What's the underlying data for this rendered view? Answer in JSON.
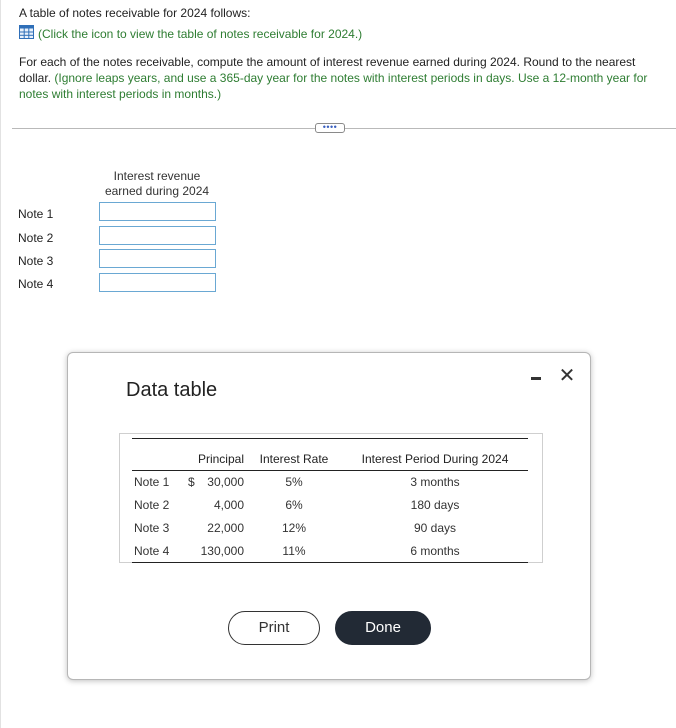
{
  "intro": "A table of notes receivable for 2024 follows:",
  "link": {
    "text": "(Click the icon to view the table of notes receivable for",
    "year": "2024.)"
  },
  "instructions": {
    "main": "For each of the notes receivable, compute the amount of interest revenue earned during 2024. Round to the nearest dollar.",
    "hint": "(Ignore leaps years, and use a 365-day year for the notes with interest periods in days. Use a 12-month year for notes with interest periods in months.)"
  },
  "ellipsis": "••••",
  "answer_table": {
    "header_line1": "Interest revenue",
    "header_line2": "earned during 2024",
    "rows": [
      {
        "label": "Note 1",
        "value": ""
      },
      {
        "label": "Note 2",
        "value": ""
      },
      {
        "label": "Note 3",
        "value": ""
      },
      {
        "label": "Note 4",
        "value": ""
      }
    ]
  },
  "modal": {
    "title": "Data table",
    "minimize_icon": "minimize-icon",
    "close_glyph": "✕",
    "columns": [
      "",
      "Principal",
      "Interest Rate",
      "Interest Period During 2024"
    ],
    "rows": [
      {
        "note": "Note 1",
        "currency": "$",
        "principal": "30,000",
        "rate": "5%",
        "period": "3 months"
      },
      {
        "note": "Note 2",
        "currency": "",
        "principal": "4,000",
        "rate": "6%",
        "period": "180 days"
      },
      {
        "note": "Note 3",
        "currency": "",
        "principal": "22,000",
        "rate": "12%",
        "period": "90 days"
      },
      {
        "note": "Note 4",
        "currency": "",
        "principal": "130,000",
        "rate": "11%",
        "period": "6 months"
      }
    ],
    "print_label": "Print",
    "done_label": "Done"
  },
  "colors": {
    "link_green": "#2e7d32",
    "input_border": "#6aa8d3",
    "done_bg": "#222a35"
  }
}
